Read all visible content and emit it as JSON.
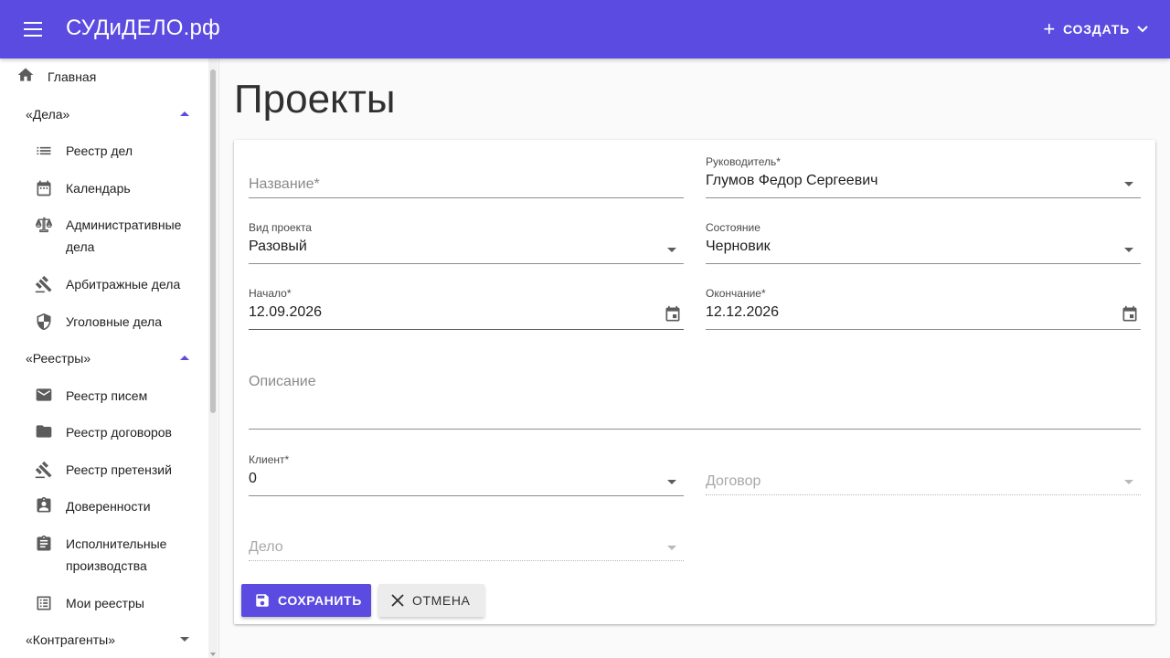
{
  "appbar": {
    "brand": "СУДиДЕЛО.рф",
    "create_label": "СОЗДАТЬ",
    "color": "#5b4be0"
  },
  "sidebar": {
    "home": {
      "label": "Главная",
      "icon": "home-icon"
    },
    "groups": [
      {
        "label": "«Дела»",
        "expanded": true,
        "items": [
          {
            "label": "Реестр дел",
            "icon": "list-icon"
          },
          {
            "label": "Календарь",
            "icon": "calendar-icon"
          },
          {
            "label": "Административные дела",
            "icon": "scales-icon"
          },
          {
            "label": "Арбитражные дела",
            "icon": "gavel-icon"
          },
          {
            "label": "Уголовные дела",
            "icon": "shield-icon"
          }
        ]
      },
      {
        "label": "«Реестры»",
        "expanded": true,
        "items": [
          {
            "label": "Реестр писем",
            "icon": "mail-icon"
          },
          {
            "label": "Реестр договоров",
            "icon": "folder-icon"
          },
          {
            "label": "Реестр претензий",
            "icon": "gavel-icon"
          },
          {
            "label": "Доверенности",
            "icon": "badge-icon"
          },
          {
            "label": "Исполнительные производства",
            "icon": "assignment-icon"
          },
          {
            "label": "Мои реестры",
            "icon": "list-alt-icon"
          }
        ]
      },
      {
        "label": "«Контрагенты»",
        "expanded": false,
        "items": []
      }
    ]
  },
  "page": {
    "title": "Проекты"
  },
  "form": {
    "name": {
      "placeholder": "Название*"
    },
    "manager": {
      "label": "Руководитель*",
      "value": "Глумов Федор Сергеевич"
    },
    "project_type": {
      "label": "Вид проекта",
      "value": "Разовый"
    },
    "state": {
      "label": "Состояние",
      "value": "Черновик"
    },
    "start": {
      "label": "Начало*",
      "value": "12.09.2026"
    },
    "end": {
      "label": "Окончание*",
      "value": "12.12.2026"
    },
    "description": {
      "placeholder": "Описание"
    },
    "client": {
      "label": "Клиент*",
      "value": "0"
    },
    "contract": {
      "placeholder": "Договор"
    },
    "case": {
      "placeholder": "Дело"
    }
  },
  "actions": {
    "save_label": "СОХРАНИТЬ",
    "cancel_label": "ОТМЕНА"
  }
}
